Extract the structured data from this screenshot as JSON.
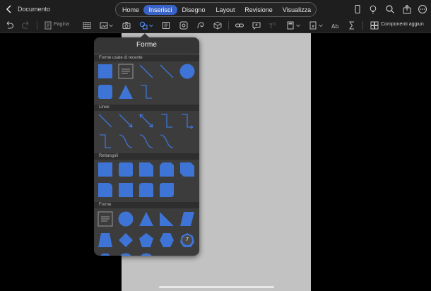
{
  "app": {
    "document_title": "Documento"
  },
  "ribbon": {
    "tabs": [
      {
        "label": "Home"
      },
      {
        "label": "Inserisci",
        "active": true
      },
      {
        "label": "Disegno"
      },
      {
        "label": "Layout"
      },
      {
        "label": "Revisione"
      },
      {
        "label": "Visualizza"
      }
    ],
    "accent_color": "#3a63c9"
  },
  "toolbar": {
    "page_label": "Pagina",
    "components_label": "Componenti aggiun"
  },
  "shapes_popover": {
    "title": "Forme",
    "sections": {
      "recent": "Forme usate di recente",
      "lines": "Linee",
      "rectangles": "Rettangoli",
      "shapes": "Forme"
    },
    "badge_number": "7",
    "shape_color": "#3e74d6"
  }
}
